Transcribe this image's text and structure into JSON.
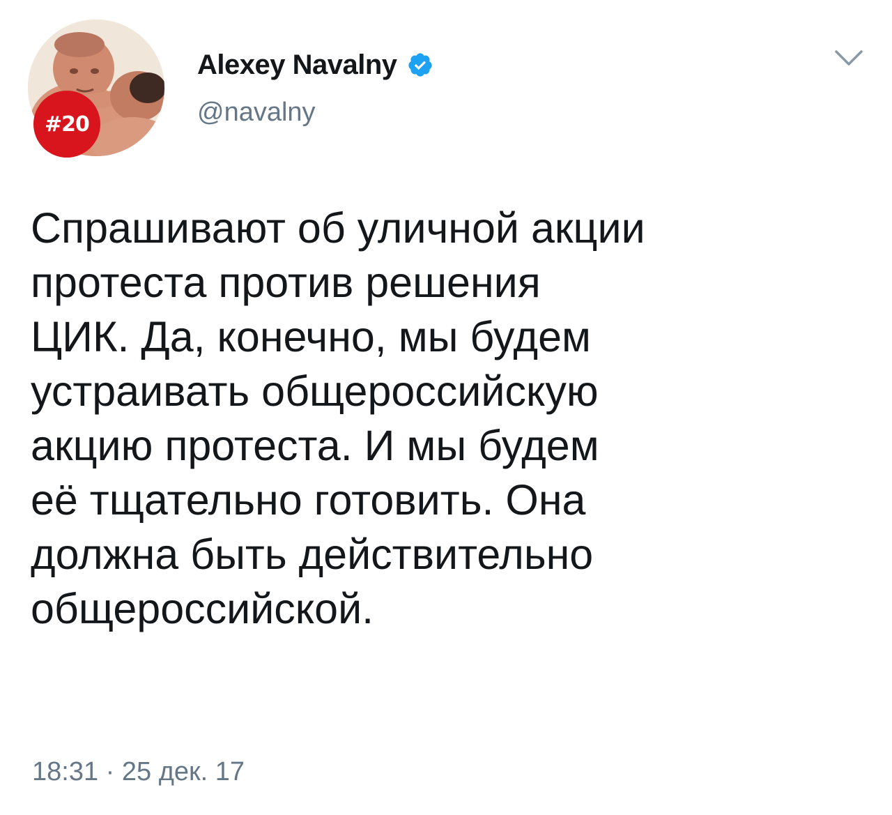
{
  "tweet": {
    "avatar": {
      "icon": "profile-photo",
      "badge_text": "#20",
      "badge_color": "#d8141d"
    },
    "display_name": "Alexey Navalny",
    "verified_icon": "verified-badge-icon",
    "verified_color": "#1da1f2",
    "handle": "@navalny",
    "menu_icon": "chevron-down-icon",
    "text_lines": [
      "Спрашивают об уличной акции",
      "протеста против решения",
      "ЦИК. Да, конечно, мы будем",
      "устраивать общероссийскую",
      "акцию протеста. И мы будем",
      "её тщательно готовить. Она",
      "должна быть действительно",
      "общероссийской."
    ],
    "timestamp": "18:31 · 25 дек. 17"
  }
}
